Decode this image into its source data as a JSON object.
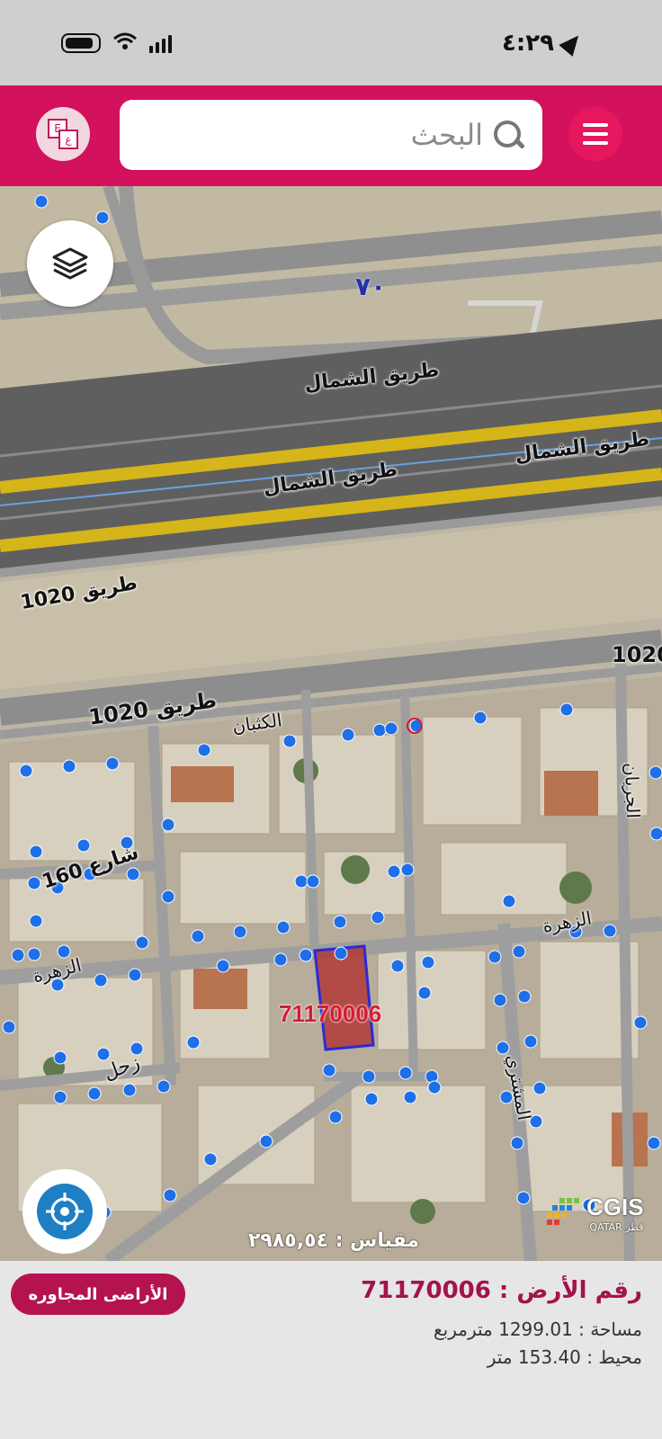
{
  "status_bar": {
    "time": "٤:٢٩"
  },
  "header": {
    "search_placeholder": "البحث",
    "lang_icon_letters": [
      "E",
      "ع"
    ],
    "colors": {
      "header_bg": "#d3115d",
      "menu_button": "#e6175f"
    }
  },
  "map": {
    "labels": {
      "route_number": "٧٠",
      "north_road_top": "طريق الشمال",
      "north_road_mid": "طريق الشمال",
      "north_road_right": "طريق الشمال",
      "road_1020_left": "طريق 1020",
      "road_1020_center": "طريق 1020",
      "road_1020_right": "1020",
      "al_kithban": "الكثبان",
      "street_160": "شارع 160",
      "zahra_left": "الزهرة",
      "zahra_right": "الزهرة",
      "zuhal": "زحل",
      "al_jiryan": "الجريان",
      "al_mushtari": "المشتري"
    },
    "parcel_label": "71170006",
    "scale_text": "مقياس : ٢٩٨٥,٥٤",
    "logo": {
      "name": "CGIS",
      "sub": "QATAR قطر"
    },
    "colors": {
      "points": "#1e6fe8",
      "parcel_fill": "#b02a2a",
      "parcel_border": "#2b2bd6"
    }
  },
  "info_panel": {
    "neighbors_button": "الأراضى المجاوره",
    "parcel_title": "رقم الأرض : 71170006",
    "area": "مساحة : 1299.01 مترمربع",
    "perimeter": "محيط : 153.40 متر",
    "colors": {
      "title": "#a3134c",
      "button": "#b5134f"
    }
  }
}
